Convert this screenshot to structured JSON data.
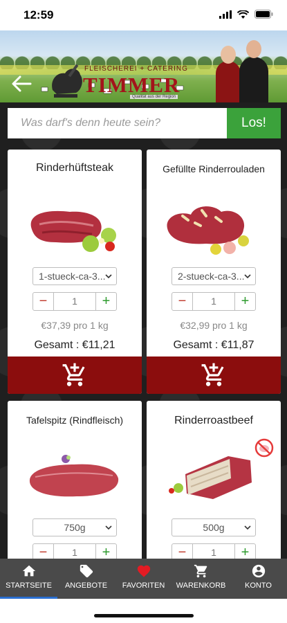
{
  "status_bar": {
    "time": "12:59"
  },
  "header": {
    "logo_top": "FLEISCHEREI + CATERING",
    "logo_main": "TIMMER",
    "logo_sub": "Qualität aus der Region"
  },
  "search": {
    "placeholder": "Was darf's denn heute sein?",
    "button_label": "Los!"
  },
  "products": [
    {
      "title": "Rinderhüftsteak",
      "variant": "1-stueck-ca-3...",
      "quantity": "1",
      "unit_price": "€37,39 pro 1 kg",
      "total": "Gesamt : €11,21"
    },
    {
      "title": "Gefüllte Rinderrouladen",
      "variant": "2-stueck-ca-3...",
      "quantity": "1",
      "unit_price": "€32,99 pro 1 kg",
      "total": "Gesamt : €11,87"
    },
    {
      "title": "Tafelspitz (Rindfleisch)",
      "variant": "750g",
      "quantity": "1"
    },
    {
      "title": "Rinderroastbeef",
      "variant": "500g",
      "quantity": "1"
    }
  ],
  "stepper": {
    "minus": "−",
    "plus": "+"
  },
  "bottom_nav": [
    {
      "label": "STARTSEITE",
      "icon": "home-icon",
      "active": true
    },
    {
      "label": "ANGEBOTE",
      "icon": "tag-icon"
    },
    {
      "label": "FAVORITEN",
      "icon": "heart-icon"
    },
    {
      "label": "WARENKORB",
      "icon": "cart-icon"
    },
    {
      "label": "KONTO",
      "icon": "account-icon"
    }
  ],
  "colors": {
    "accent_red": "#8b0d0d",
    "search_green": "#3ba23b",
    "nav_bg": "#4a4a4a",
    "favorite_red": "#e31b23"
  }
}
